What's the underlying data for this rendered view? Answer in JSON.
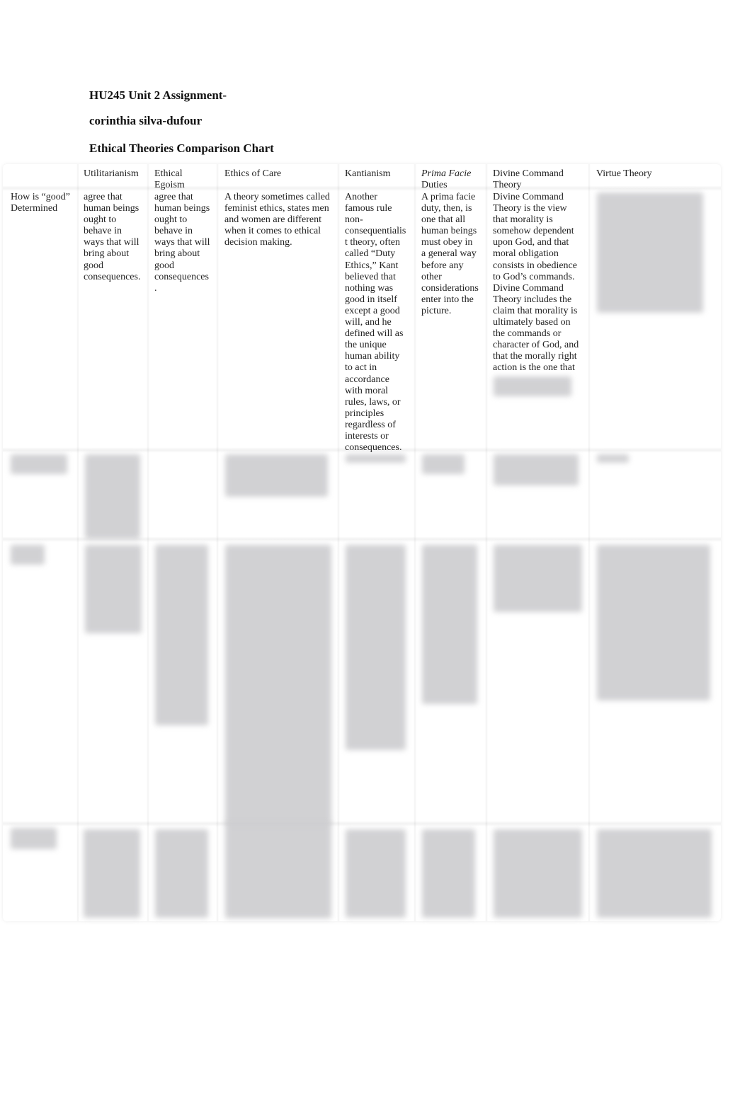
{
  "document": {
    "title": "HU245 Unit 2 Assignment-",
    "author": "corinthia silva-dufour",
    "chart_title": "Ethical Theories Comparison Chart"
  },
  "table": {
    "columns": [
      {
        "label": "Utilitarianism"
      },
      {
        "label": "Ethical\nEgoism"
      },
      {
        "label": "Ethics of Care"
      },
      {
        "label": "Kantianism"
      },
      {
        "label_italic": "Prima Facie",
        "label": "\nDuties"
      },
      {
        "label": "Divine Command\nTheory"
      },
      {
        "label": "Virtue Theory"
      }
    ],
    "rows": [
      {
        "header": "How is “good”\nDetermined",
        "cells": [
          "agree that\nhuman beings\nought to\nbehave in\nways that will\nbring about\ngood\nconsequences.",
          "agree that\nhuman beings\nought to\nbehave in\nways that will\nbring about\ngood\nconsequences\n.",
          "A theory sometimes called\nfeminist ethics, states men\nand women are different\nwhen it comes to ethical\ndecision making.",
          "Another\nfamous rule\nnon-\nconsequentialis\nt theory, often\ncalled “Duty\nEthics,” Kant\nbelieved that\nnothing was\ngood in itself\nexcept a good\nwill, and he\ndefined will as\nthe unique\nhuman ability\nto act in\naccordance\nwith moral\nrules, laws, or\nprinciples\nregardless of\ninterests or\nconsequences.",
          "A prima facie\nduty, then, is\none that all\nhuman beings\nmust obey in\na general way\nbefore any\nother\nconsiderations\nenter into the\npicture.",
          "Divine Command\nTheory is the view\nthat morality is\nsomehow dependent\nupon God, and that\nmoral obligation\nconsists in obedience\nto God’s commands.\nDivine Command\nTheory includes the\nclaim that morality is\nultimately based on\nthe commands or\ncharacter of God, and\nthat the morally right\naction is the one that",
          ""
        ]
      },
      {
        "header": "",
        "cells": [
          "",
          "",
          "",
          "",
          "",
          "",
          ""
        ]
      },
      {
        "header": "",
        "cells": [
          "",
          "",
          "",
          "",
          "",
          "",
          ""
        ]
      },
      {
        "header": "",
        "cells": [
          "",
          "",
          "",
          "",
          "",
          "",
          ""
        ]
      }
    ]
  }
}
